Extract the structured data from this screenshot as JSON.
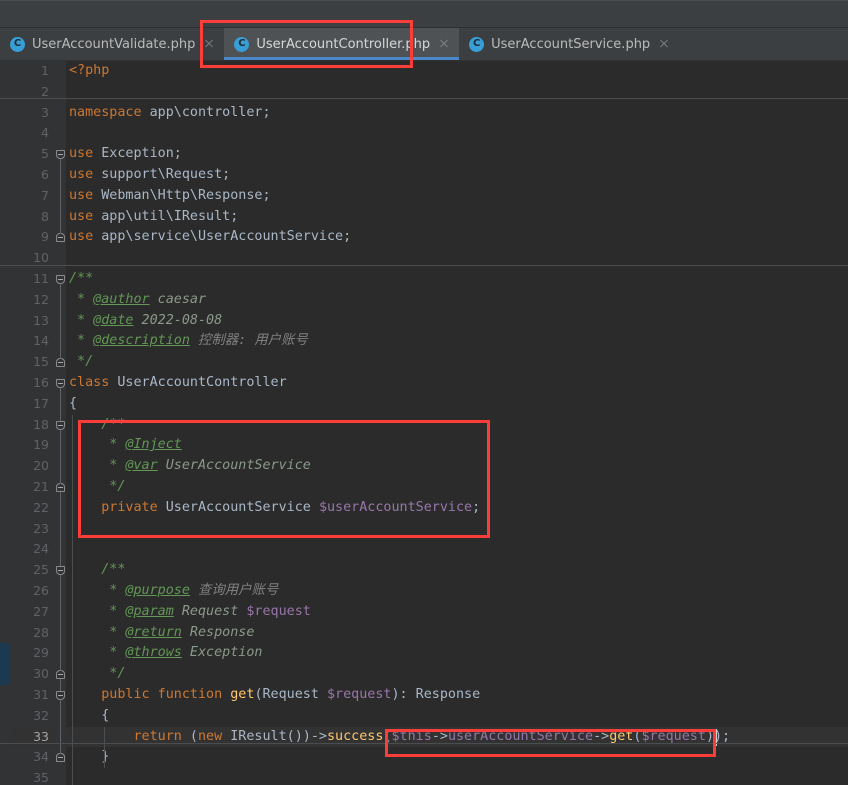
{
  "window": {
    "app": "PhpStorm Editor",
    "theme_accent": "#4a88c7",
    "editor_background": "#2b2b2b",
    "gutter_background": "#313335",
    "chrome_background": "#3c3f41",
    "annotation_color": "#fc3d39"
  },
  "tabs": [
    {
      "icon": "php-class-icon",
      "icon_letter": "C",
      "label": "UserAccountValidate.php",
      "active": false,
      "close_icon": "close-icon"
    },
    {
      "icon": "php-class-icon",
      "icon_letter": "C",
      "label": "UserAccountController.php",
      "active": true,
      "close_icon": "close-icon"
    },
    {
      "icon": "php-class-icon",
      "icon_letter": "C",
      "label": "UserAccountService.php",
      "active": false,
      "close_icon": "close-icon"
    }
  ],
  "editor": {
    "current_line": 33,
    "first_line": 1,
    "last_line": 35,
    "lines": [
      {
        "n": 1,
        "indent": 0,
        "tokens": [
          {
            "t": "<?php",
            "c": "php"
          }
        ]
      },
      {
        "n": 2,
        "indent": 0,
        "tokens": []
      },
      {
        "n": 3,
        "indent": 0,
        "tokens": [
          {
            "t": "namespace",
            "c": "kw"
          },
          {
            "t": " app\\controller;",
            "c": "id"
          }
        ]
      },
      {
        "n": 4,
        "indent": 0,
        "tokens": []
      },
      {
        "n": 5,
        "indent": 0,
        "tokens": [
          {
            "t": "use",
            "c": "kw"
          },
          {
            "t": " Exception;",
            "c": "id"
          }
        ]
      },
      {
        "n": 6,
        "indent": 0,
        "tokens": [
          {
            "t": "use",
            "c": "kw"
          },
          {
            "t": " support\\Request;",
            "c": "id"
          }
        ]
      },
      {
        "n": 7,
        "indent": 0,
        "tokens": [
          {
            "t": "use",
            "c": "kw"
          },
          {
            "t": " Webman\\Http\\Response;",
            "c": "id"
          }
        ]
      },
      {
        "n": 8,
        "indent": 0,
        "tokens": [
          {
            "t": "use",
            "c": "kw"
          },
          {
            "t": " app\\util\\IResult;",
            "c": "id"
          }
        ]
      },
      {
        "n": 9,
        "indent": 0,
        "tokens": [
          {
            "t": "use",
            "c": "kw"
          },
          {
            "t": " app\\service\\UserAccountService;",
            "c": "id"
          }
        ]
      },
      {
        "n": 10,
        "indent": 0,
        "tokens": []
      },
      {
        "n": 11,
        "indent": 0,
        "tokens": [
          {
            "t": "/**",
            "c": "cmt"
          }
        ]
      },
      {
        "n": 12,
        "indent": 0,
        "tokens": [
          {
            "t": " * ",
            "c": "cmt"
          },
          {
            "t": "@author",
            "c": "ctag"
          },
          {
            "t": " caesar",
            "c": "ctxt"
          }
        ]
      },
      {
        "n": 13,
        "indent": 0,
        "tokens": [
          {
            "t": " * ",
            "c": "cmt"
          },
          {
            "t": "@date",
            "c": "ctag"
          },
          {
            "t": " 2022-08-08",
            "c": "ctxt"
          }
        ]
      },
      {
        "n": 14,
        "indent": 0,
        "tokens": [
          {
            "t": " * ",
            "c": "cmt"
          },
          {
            "t": "@description",
            "c": "ctag"
          },
          {
            "t": " 控制器: 用户账号",
            "c": "ctxt2"
          }
        ]
      },
      {
        "n": 15,
        "indent": 0,
        "tokens": [
          {
            "t": " */",
            "c": "cmt"
          }
        ]
      },
      {
        "n": 16,
        "indent": 0,
        "tokens": [
          {
            "t": "class",
            "c": "kw"
          },
          {
            "t": " UserAccountController",
            "c": "cls"
          }
        ]
      },
      {
        "n": 17,
        "indent": 0,
        "tokens": [
          {
            "t": "{",
            "c": "id"
          }
        ]
      },
      {
        "n": 18,
        "indent": 1,
        "tokens": [
          {
            "t": "    /**",
            "c": "cmt"
          }
        ]
      },
      {
        "n": 19,
        "indent": 1,
        "tokens": [
          {
            "t": "     * ",
            "c": "cmt"
          },
          {
            "t": "@Inject",
            "c": "ctag"
          }
        ]
      },
      {
        "n": 20,
        "indent": 1,
        "tokens": [
          {
            "t": "     * ",
            "c": "cmt"
          },
          {
            "t": "@var",
            "c": "ctag"
          },
          {
            "t": " UserAccountService",
            "c": "ctxt"
          }
        ]
      },
      {
        "n": 21,
        "indent": 1,
        "tokens": [
          {
            "t": "     */",
            "c": "cmt"
          }
        ]
      },
      {
        "n": 22,
        "indent": 1,
        "tokens": [
          {
            "t": "    ",
            "c": "id"
          },
          {
            "t": "private",
            "c": "kw"
          },
          {
            "t": " UserAccountService ",
            "c": "cls"
          },
          {
            "t": "$userAccountService",
            "c": "var"
          },
          {
            "t": ";",
            "c": "id"
          }
        ]
      },
      {
        "n": 23,
        "indent": 1,
        "tokens": []
      },
      {
        "n": 24,
        "indent": 1,
        "tokens": []
      },
      {
        "n": 25,
        "indent": 1,
        "tokens": [
          {
            "t": "    /**",
            "c": "cmt"
          }
        ]
      },
      {
        "n": 26,
        "indent": 1,
        "tokens": [
          {
            "t": "     * ",
            "c": "cmt"
          },
          {
            "t": "@purpose",
            "c": "ctag"
          },
          {
            "t": " 查询用户账号",
            "c": "ctxt2"
          }
        ]
      },
      {
        "n": 27,
        "indent": 1,
        "tokens": [
          {
            "t": "     * ",
            "c": "cmt"
          },
          {
            "t": "@param",
            "c": "ctag"
          },
          {
            "t": " Request ",
            "c": "ctxt"
          },
          {
            "t": "$request",
            "c": "var"
          }
        ]
      },
      {
        "n": 28,
        "indent": 1,
        "tokens": [
          {
            "t": "     * ",
            "c": "cmt"
          },
          {
            "t": "@return",
            "c": "ctag"
          },
          {
            "t": " Response",
            "c": "ctxt"
          }
        ]
      },
      {
        "n": 29,
        "indent": 1,
        "tokens": [
          {
            "t": "     * ",
            "c": "cmt"
          },
          {
            "t": "@throws",
            "c": "ctag"
          },
          {
            "t": " Exception",
            "c": "ctxt"
          }
        ]
      },
      {
        "n": 30,
        "indent": 1,
        "tokens": [
          {
            "t": "     */",
            "c": "cmt"
          }
        ]
      },
      {
        "n": 31,
        "indent": 1,
        "tokens": [
          {
            "t": "    ",
            "c": "id"
          },
          {
            "t": "public function ",
            "c": "kw"
          },
          {
            "t": "get",
            "c": "fn"
          },
          {
            "t": "(Request ",
            "c": "id"
          },
          {
            "t": "$request",
            "c": "var"
          },
          {
            "t": "): Response",
            "c": "id"
          }
        ]
      },
      {
        "n": 32,
        "indent": 1,
        "tokens": [
          {
            "t": "    {",
            "c": "id"
          }
        ]
      },
      {
        "n": 33,
        "indent": 2,
        "tokens": [
          {
            "t": "        ",
            "c": "id"
          },
          {
            "t": "return",
            "c": "kw"
          },
          {
            "t": " (",
            "c": "id"
          },
          {
            "t": "new",
            "c": "kw"
          },
          {
            "t": " IResult())->",
            "c": "id"
          },
          {
            "t": "success",
            "c": "fn"
          },
          {
            "t": "(",
            "c": "id"
          },
          {
            "t": "$this",
            "c": "var"
          },
          {
            "t": "->",
            "c": "id"
          },
          {
            "t": "userAccountService",
            "c": "var"
          },
          {
            "t": "->",
            "c": "id"
          },
          {
            "t": "get",
            "c": "fn"
          },
          {
            "t": "(",
            "c": "id"
          },
          {
            "t": "$request",
            "c": "var"
          },
          {
            "t": "));",
            "c": "id"
          }
        ]
      },
      {
        "n": 34,
        "indent": 1,
        "tokens": [
          {
            "t": "    }",
            "c": "id"
          }
        ]
      },
      {
        "n": 35,
        "indent": 0,
        "tokens": []
      }
    ]
  },
  "annotations": [
    {
      "name": "tab-highlight-box",
      "label": "UserAccountController.php tab highlighted"
    },
    {
      "name": "inject-property-box",
      "label": "@Inject property declaration highlighted"
    },
    {
      "name": "service-call-box",
      "label": "$this->userAccountService->get($request) highlighted"
    }
  ]
}
